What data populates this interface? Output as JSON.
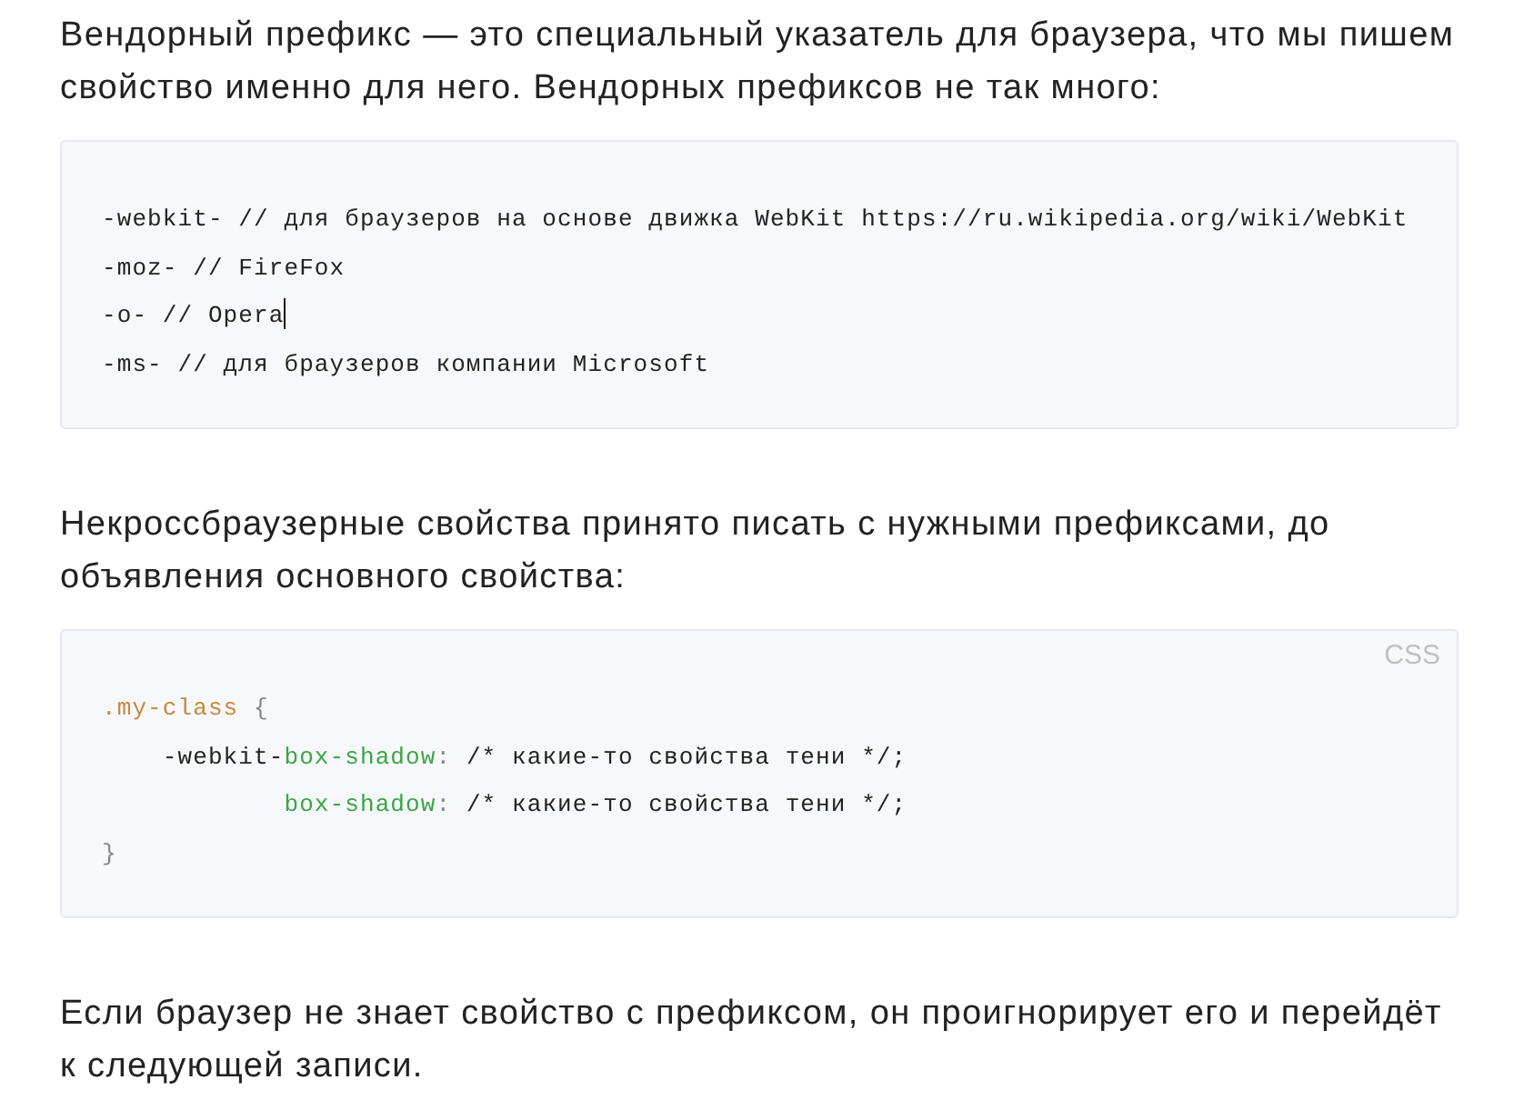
{
  "blocks": [
    {
      "kind": "paragraph",
      "text": "Вендорный префикс — это специальный указатель для браузера, что мы пишем свойство именно для него. Вендорных префиксов не так много:"
    },
    {
      "kind": "code",
      "lines": [
        {
          "tokens": [
            {
              "kind": "plain",
              "text": "-webkit- // для браузеров на основе движка WebKit https://ru.wikipedia.org/wiki/WebKit"
            }
          ]
        },
        {
          "tokens": [
            {
              "kind": "plain",
              "text": "-moz- // FireFox"
            }
          ]
        },
        {
          "tokens": [
            {
              "kind": "plain",
              "text": "-o- // Opera"
            }
          ],
          "cursor": true
        },
        {
          "tokens": [
            {
              "kind": "plain",
              "text": "-ms- // для браузеров компании Microsoft"
            }
          ]
        }
      ]
    },
    {
      "kind": "paragraph",
      "text": "Некроссбраузерные свойства принято писать с нужными префиксами, до объявления основного свойства:"
    },
    {
      "kind": "code",
      "language": "CSS",
      "lines": [
        {
          "tokens": [
            {
              "kind": "selector",
              "text": ".my-class"
            },
            {
              "kind": "punct",
              "text": " {"
            }
          ]
        },
        {
          "tokens": [
            {
              "kind": "plain",
              "text": "    -webkit-"
            },
            {
              "kind": "property",
              "text": "box-shadow"
            },
            {
              "kind": "punct",
              "text": ":"
            },
            {
              "kind": "plain",
              "text": " /* какие-то свойства тени */;"
            }
          ]
        },
        {
          "tokens": [
            {
              "kind": "property",
              "text": "            box-shadow"
            },
            {
              "kind": "punct",
              "text": ":"
            },
            {
              "kind": "plain",
              "text": " /* какие-то свойства тени */;"
            }
          ]
        },
        {
          "tokens": [
            {
              "kind": "punct",
              "text": "}"
            }
          ]
        }
      ]
    },
    {
      "kind": "paragraph",
      "text": "Если браузер не знает свойство с префиксом, он проигнорирует его и перейдёт к следующей записи."
    }
  ]
}
